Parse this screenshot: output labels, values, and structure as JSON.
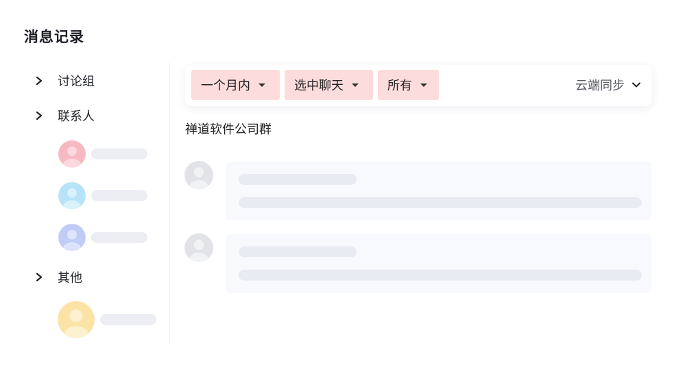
{
  "page": {
    "title": "消息记录"
  },
  "sidebar": {
    "groups": [
      {
        "label": "讨论组"
      },
      {
        "label": "联系人"
      },
      {
        "label": "其他"
      }
    ],
    "contacts": [
      {
        "avatar_color": "#f7b9c1"
      },
      {
        "avatar_color": "#b6e3f7"
      },
      {
        "avatar_color": "#c0ccf5"
      },
      {
        "avatar_color": "#fbe3a6"
      }
    ]
  },
  "toolbar": {
    "filters": [
      {
        "label": "一个月内"
      },
      {
        "label": "选中聊天"
      },
      {
        "label": "所有"
      }
    ],
    "sync_label": "云端同步",
    "filter_bg": "#fcdcdc"
  },
  "chat": {
    "title": "禅道软件公司群"
  }
}
